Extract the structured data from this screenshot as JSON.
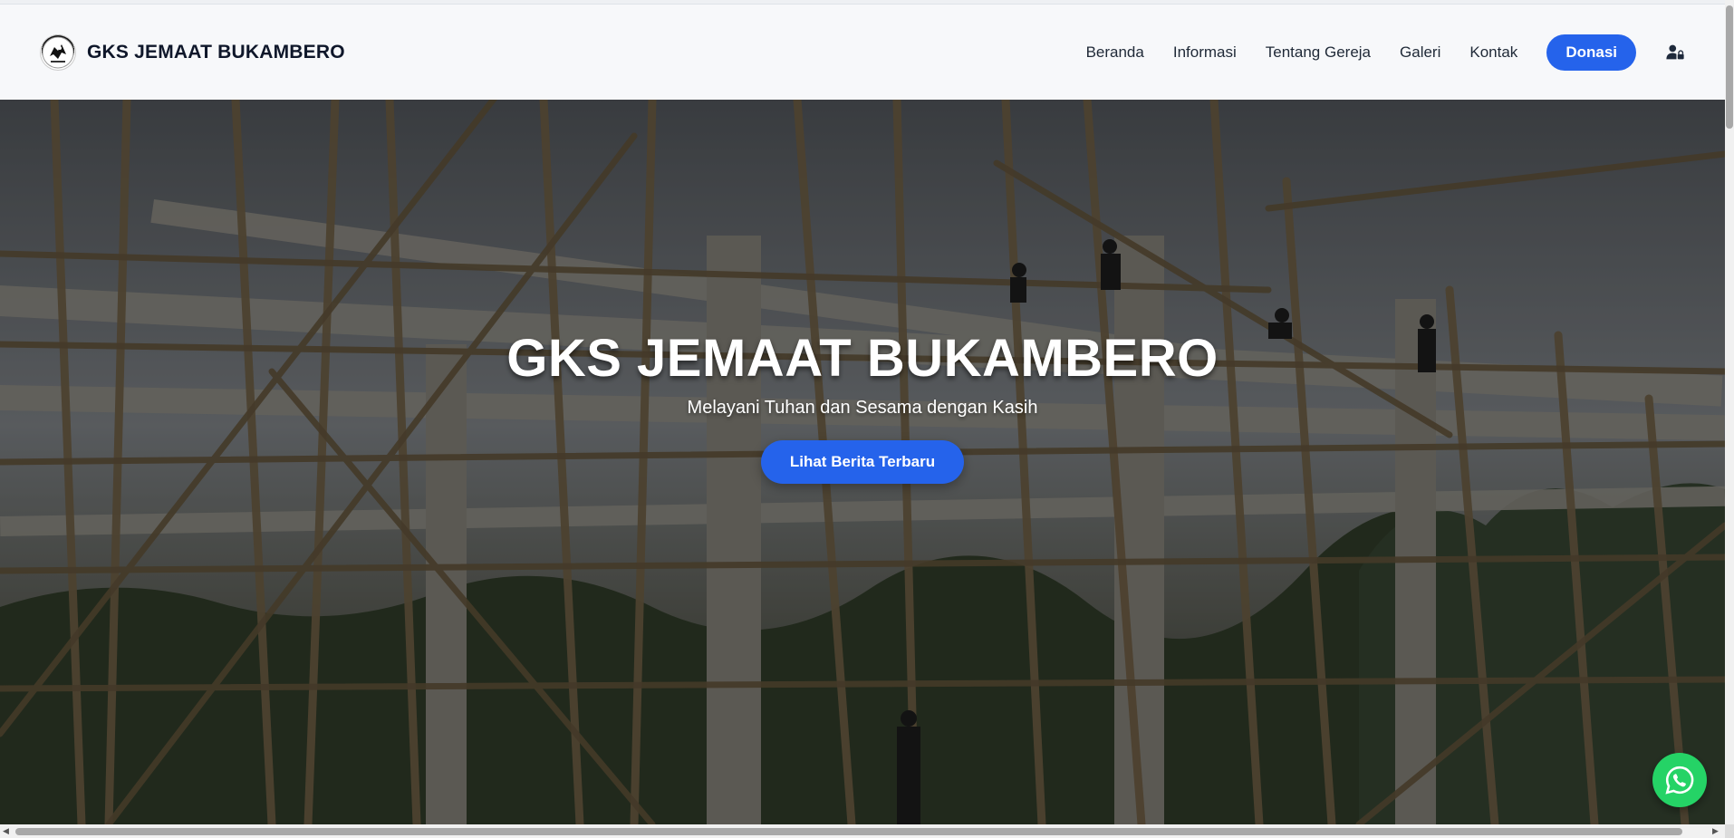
{
  "navbar": {
    "brand": "GKS JEMAAT BUKAMBERO",
    "links": [
      {
        "label": "Beranda"
      },
      {
        "label": "Informasi"
      },
      {
        "label": "Tentang Gereja"
      },
      {
        "label": "Galeri"
      },
      {
        "label": "Kontak"
      }
    ],
    "donate_label": "Donasi",
    "user_icon": "user-lock-icon",
    "logo_icon": "church-emblem-icon"
  },
  "hero": {
    "title": "GKS JEMAAT BUKAMBERO",
    "subtitle": "Melayani Tuhan dan Sesama dengan Kasih",
    "cta_label": "Lihat Berita Terbaru",
    "background": "construction-scaffolding-photo"
  },
  "floating": {
    "whatsapp_icon": "whatsapp-icon"
  },
  "colors": {
    "accent": "#2563eb",
    "navbar_bg": "#f7f8fa",
    "brand_text": "#0f172a",
    "whatsapp": "#25d366"
  }
}
